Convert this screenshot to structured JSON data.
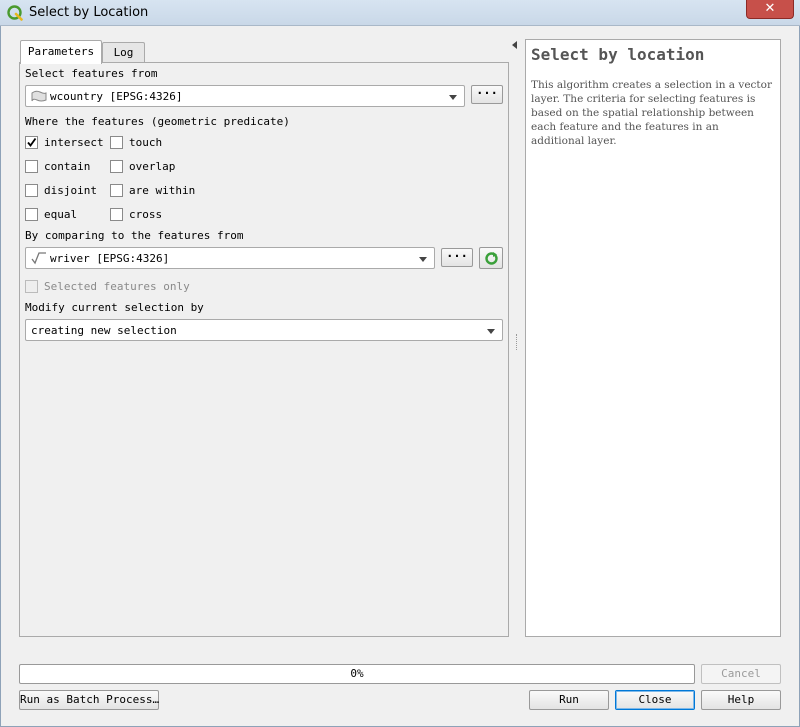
{
  "window": {
    "title": "Select by Location",
    "close_glyph": "✕"
  },
  "tabs": [
    {
      "label": "Parameters"
    },
    {
      "label": "Log"
    }
  ],
  "params": {
    "select_from_label": "Select features from",
    "select_from_value": "wcountry [EPSG:4326]",
    "predicate_label": "Where the features (geometric predicate)",
    "predicates": [
      {
        "label": "intersect",
        "checked": true
      },
      {
        "label": "touch",
        "checked": false
      },
      {
        "label": "contain",
        "checked": false
      },
      {
        "label": "overlap",
        "checked": false
      },
      {
        "label": "disjoint",
        "checked": false
      },
      {
        "label": "are within",
        "checked": false
      },
      {
        "label": "equal",
        "checked": false
      },
      {
        "label": "cross",
        "checked": false
      }
    ],
    "compare_label": "By comparing to the features from",
    "compare_value": "wriver [EPSG:4326]",
    "selected_only_label": "Selected features only",
    "modify_label": "Modify current selection by",
    "modify_value": "creating new selection",
    "ellipsis": "···"
  },
  "help": {
    "title": "Select by location",
    "body": "This algorithm creates a selection in a vector layer. The criteria for selecting features is based on the spatial relationship between each feature and the features in an additional layer."
  },
  "progress": {
    "text": "0%",
    "value": 0
  },
  "buttons": {
    "cancel": "Cancel",
    "batch": "Run as Batch Process…",
    "run": "Run",
    "close": "Close",
    "help": "Help"
  },
  "icons": {
    "app": "qgis-icon",
    "polygon_layer": "polygon-layer-icon",
    "line_layer": "line-layer-icon",
    "iterate": "iterate-icon",
    "collapse": "collapse-arrow-icon"
  },
  "colors": {
    "accent": "#0078d7",
    "iterate_green": "#3aa03a",
    "close_red": "#c7504a"
  }
}
